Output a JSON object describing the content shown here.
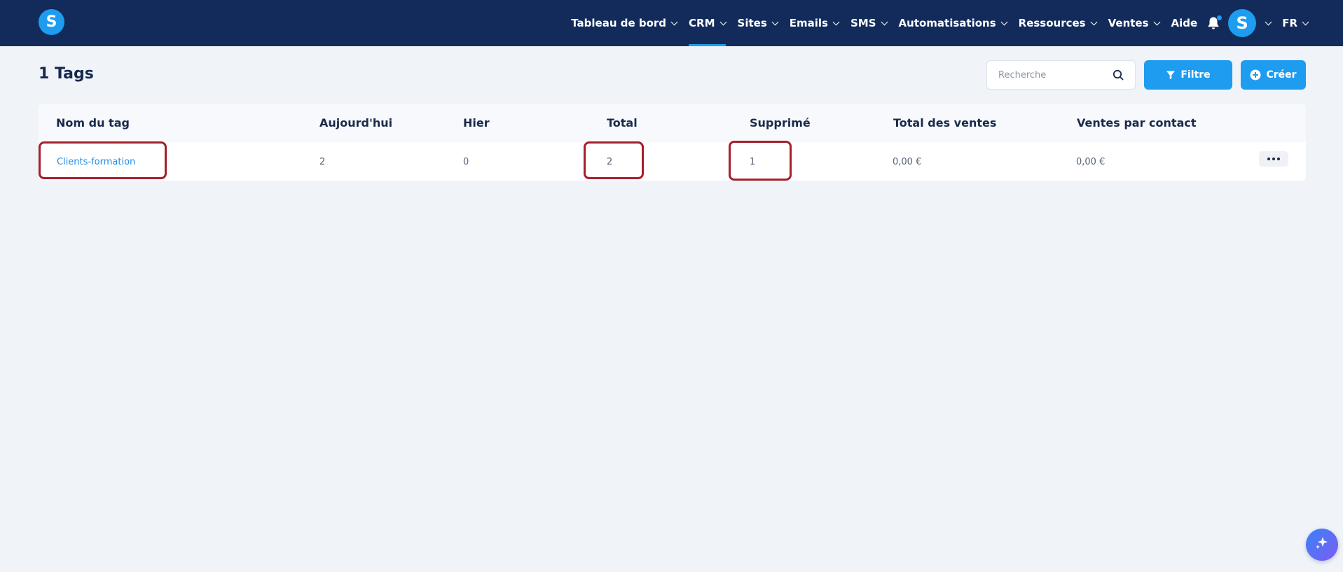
{
  "app": {
    "logo_letter": "S"
  },
  "nav": {
    "items": [
      {
        "label": "Tableau de bord",
        "dropdown": true
      },
      {
        "label": "CRM",
        "dropdown": true,
        "active": true
      },
      {
        "label": "Sites",
        "dropdown": true
      },
      {
        "label": "Emails",
        "dropdown": true
      },
      {
        "label": "SMS",
        "dropdown": true
      },
      {
        "label": "Automatisations",
        "dropdown": true
      },
      {
        "label": "Ressources",
        "dropdown": true
      },
      {
        "label": "Ventes",
        "dropdown": true
      },
      {
        "label": "Aide",
        "dropdown": false
      }
    ],
    "avatar_letter": "S",
    "language": "FR"
  },
  "page": {
    "title": "1 Tags",
    "search_placeholder": "Recherche",
    "filter_label": "Filtre",
    "create_label": "Créer"
  },
  "table": {
    "columns": [
      "Nom du tag",
      "Aujourd'hui",
      "Hier",
      "Total",
      "Supprimé",
      "Total des ventes",
      "Ventes par contact"
    ],
    "rows": [
      {
        "name": "Clients-formation",
        "today": "2",
        "yesterday": "0",
        "total": "2",
        "deleted": "1",
        "total_sales": "0,00 €",
        "sales_per_contact": "0,00 €"
      }
    ]
  },
  "colors": {
    "topbar": "#132b5b",
    "accent": "#1e9cf0",
    "highlight": "#a51f2a",
    "background": "#f0f3f8"
  }
}
